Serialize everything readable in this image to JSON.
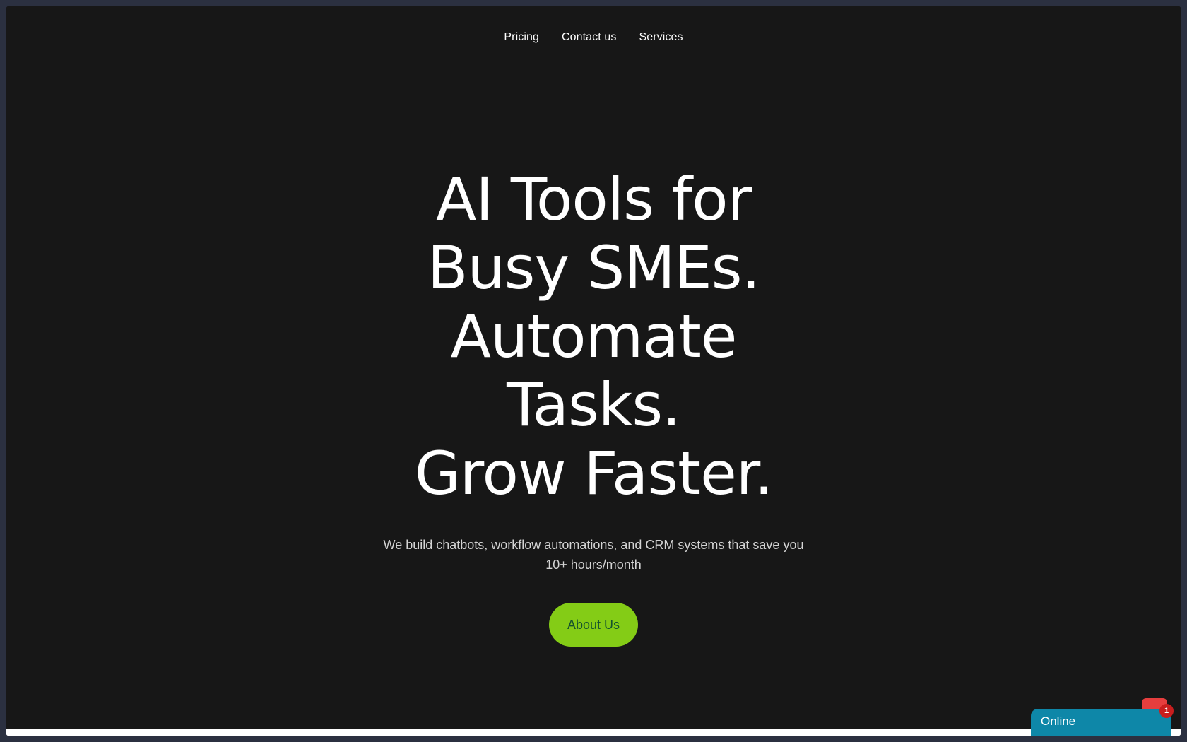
{
  "nav": {
    "items": [
      {
        "label": "Pricing"
      },
      {
        "label": "Contact us"
      },
      {
        "label": "Services"
      }
    ]
  },
  "hero": {
    "headline_lines": [
      "AI Tools for",
      "Busy SMEs.",
      "Automate",
      "Tasks.",
      "Grow Faster."
    ],
    "subtitle": "We build chatbots, workflow automations, and CRM systems that save you 10+ hours/month",
    "cta_label": "About Us"
  },
  "chat_widget": {
    "status_label": "Online",
    "badge_count": "1"
  },
  "colors": {
    "background": "#171717",
    "accent": "#84cc16",
    "cta_text": "#14532d",
    "chat": "#0e87a8",
    "badge": "#c81e1e"
  }
}
